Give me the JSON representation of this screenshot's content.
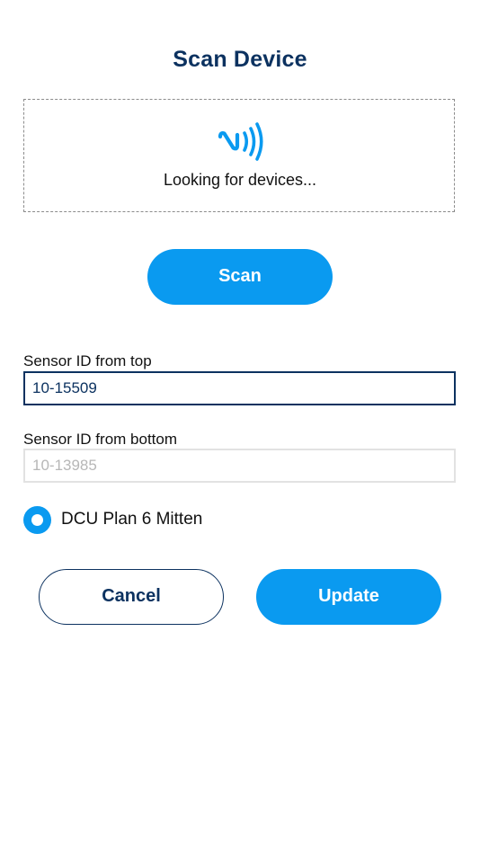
{
  "header": {
    "title": "Scan Device"
  },
  "scanner": {
    "icon": "nfc-icon",
    "status_text": "Looking for devices...",
    "scan_label": "Scan"
  },
  "form": {
    "top_sensor": {
      "label": "Sensor ID from top",
      "value": "10-15509"
    },
    "bottom_sensor": {
      "label": "Sensor ID from bottom",
      "placeholder": "10-13985"
    },
    "option": {
      "label": "DCU Plan 6 Mitten",
      "selected": true
    }
  },
  "actions": {
    "cancel_label": "Cancel",
    "update_label": "Update"
  },
  "colors": {
    "primary": "#0a9af0",
    "navy": "#0c3260"
  }
}
